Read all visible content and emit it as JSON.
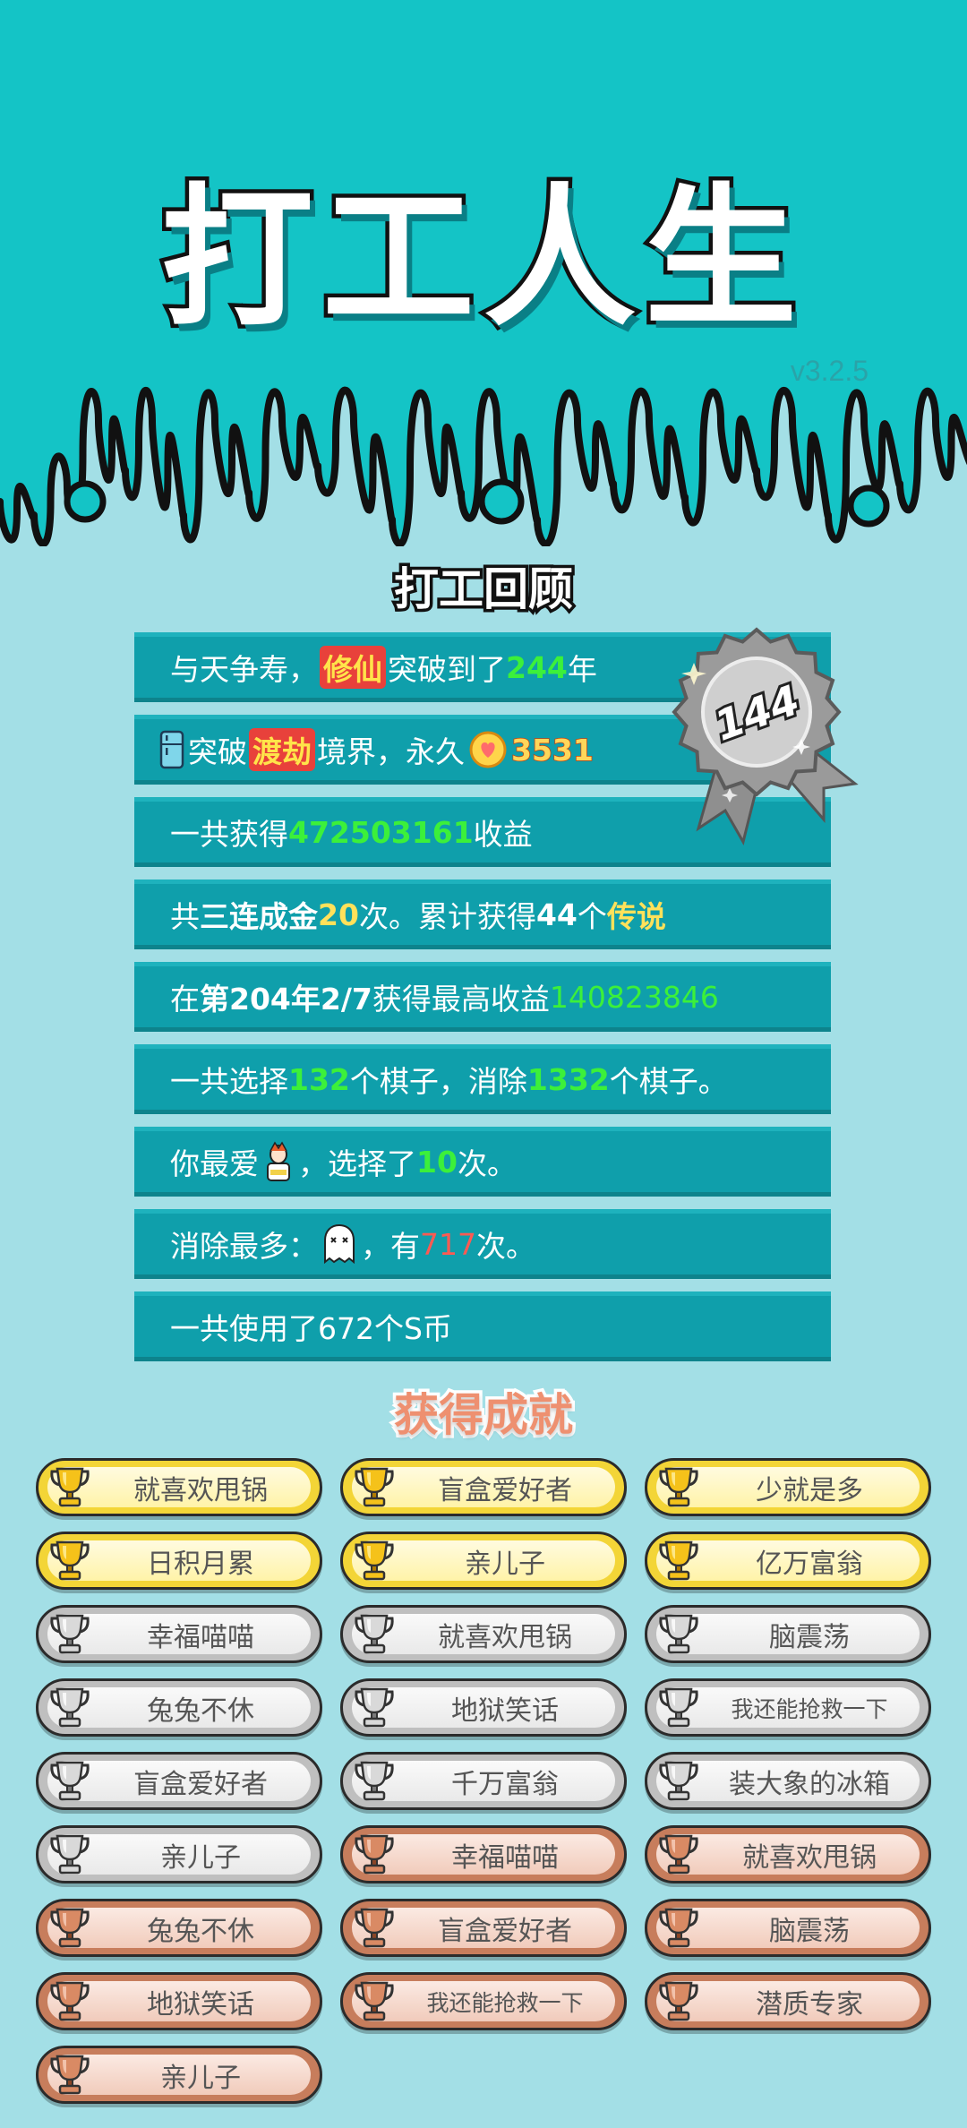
{
  "app": {
    "title": "打工人生",
    "version": "v3.2.5"
  },
  "review": {
    "title": "打工回顾",
    "rows": [
      {
        "a": "与天争寿，",
        "realm": "修仙",
        "b": "突破到了",
        "years": "244",
        "c": "年"
      },
      {
        "a": "突破",
        "realm": "渡劫",
        "b": "境界，永久",
        "coins": "3531"
      },
      {
        "a": "一共获得",
        "income": "472503161",
        "b": "收益"
      },
      {
        "a": "共",
        "combo": "三连成金",
        "count": "20",
        "b": "次。累计获得",
        "legend_count": "44",
        "c": "个",
        "legend": "传说"
      },
      {
        "a": "在 ",
        "date": "第204年2/7",
        "b": " 获得最高收益",
        "max_income": "140823846"
      },
      {
        "a": "一共选择",
        "chosen": "132",
        "b": "个棋子，消除",
        "eliminated": "1332",
        "c": "个棋子。"
      },
      {
        "a": "你最爱",
        "b": "，选择了",
        "fav_count": "10",
        "c": "次。"
      },
      {
        "a": "消除最多：",
        "b": "，有",
        "most_count": "717",
        "c": "次。"
      },
      {
        "a": "一共使用了672个S币"
      }
    ],
    "medal": {
      "number": "144"
    }
  },
  "achievements": {
    "title": "获得成就",
    "items": [
      {
        "label": "就喜欢甩锅",
        "tier": "gold"
      },
      {
        "label": "盲盒爱好者",
        "tier": "gold"
      },
      {
        "label": "少就是多",
        "tier": "gold"
      },
      {
        "label": "日积月累",
        "tier": "gold"
      },
      {
        "label": "亲儿子",
        "tier": "gold"
      },
      {
        "label": "亿万富翁",
        "tier": "gold"
      },
      {
        "label": "幸福喵喵",
        "tier": "silver"
      },
      {
        "label": "就喜欢甩锅",
        "tier": "silver"
      },
      {
        "label": "脑震荡",
        "tier": "silver"
      },
      {
        "label": "兔兔不休",
        "tier": "silver"
      },
      {
        "label": "地狱笑话",
        "tier": "silver"
      },
      {
        "label": "我还能抢救一下",
        "tier": "silver"
      },
      {
        "label": "盲盒爱好者",
        "tier": "silver"
      },
      {
        "label": "千万富翁",
        "tier": "silver"
      },
      {
        "label": "装大象的冰箱",
        "tier": "silver"
      },
      {
        "label": "亲儿子",
        "tier": "silver"
      },
      {
        "label": "幸福喵喵",
        "tier": "bronze"
      },
      {
        "label": "就喜欢甩锅",
        "tier": "bronze"
      },
      {
        "label": "兔兔不休",
        "tier": "bronze"
      },
      {
        "label": "盲盒爱好者",
        "tier": "bronze"
      },
      {
        "label": "脑震荡",
        "tier": "bronze"
      },
      {
        "label": "地狱笑话",
        "tier": "bronze"
      },
      {
        "label": "我还能抢救一下",
        "tier": "bronze"
      },
      {
        "label": "潜质专家",
        "tier": "bronze"
      },
      {
        "label": "亲儿子",
        "tier": "bronze"
      }
    ]
  },
  "colors": {
    "header": "#14c4c6",
    "background": "#a3dfe6",
    "row": "#0f9fab",
    "highlight_green": "#3cf03a",
    "highlight_red": "#ff5a52",
    "gold": "#f3d537",
    "silver": "#bfbfbf",
    "bronze": "#c77d5c"
  }
}
